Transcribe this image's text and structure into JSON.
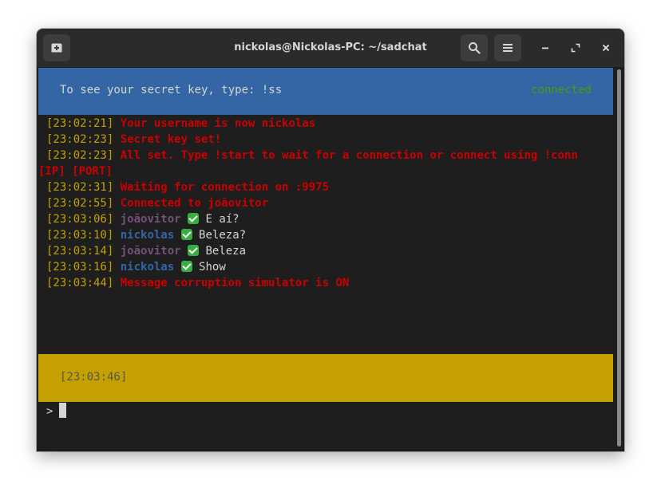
{
  "window": {
    "title": "nickolas@Nickolas-PC: ~/sadchat"
  },
  "icons": {
    "new_tab": "new-tab-icon",
    "search": "search-icon",
    "menu": "hamburger-menu-icon",
    "minimize": "minimize-icon",
    "maximize": "maximize-icon",
    "close": "close-icon",
    "sent": "check-mark-icon"
  },
  "header_banner": {
    "hint": "To see your secret key, type: !ss",
    "status": "connected"
  },
  "log": [
    {
      "ts": "[23:02:21]",
      "kind": "system",
      "text": "Your username is now nickolas"
    },
    {
      "ts": "[23:02:23]",
      "kind": "system",
      "text": "Secret key set!"
    },
    {
      "ts": "[23:02:23]",
      "kind": "system",
      "text": "All set. Type !start to wait for a connection or connect using !conn"
    },
    {
      "ts": "",
      "kind": "system",
      "text": "[IP] [PORT]"
    },
    {
      "ts": "[23:02:31]",
      "kind": "system",
      "text": "Waiting for connection on :9975"
    },
    {
      "ts": "[23:02:55]",
      "kind": "system",
      "text": "Connected to joãovitor"
    },
    {
      "ts": "[23:03:06]",
      "kind": "chat",
      "user": "joãovitor",
      "text": "E aí?"
    },
    {
      "ts": "[23:03:10]",
      "kind": "chat",
      "user": "nickolas",
      "text": "Beleza?"
    },
    {
      "ts": "[23:03:14]",
      "kind": "chat",
      "user": "joãovitor",
      "text": "Beleza"
    },
    {
      "ts": "[23:03:16]",
      "kind": "chat",
      "user": "nickolas",
      "text": "Show"
    },
    {
      "ts": "[23:03:44]",
      "kind": "system",
      "text": "Message corruption simulator is ON"
    }
  ],
  "footer_banner": {
    "clock": "[23:03:46]"
  },
  "input": {
    "prompt": ">",
    "value": ""
  },
  "colors": {
    "blue_banner": "#3465a4",
    "yellow_banner": "#c4a000",
    "system_text": "#cc0000",
    "connected": "#4e9a06",
    "user_joao": "#75507b",
    "user_nick": "#3465a4"
  }
}
